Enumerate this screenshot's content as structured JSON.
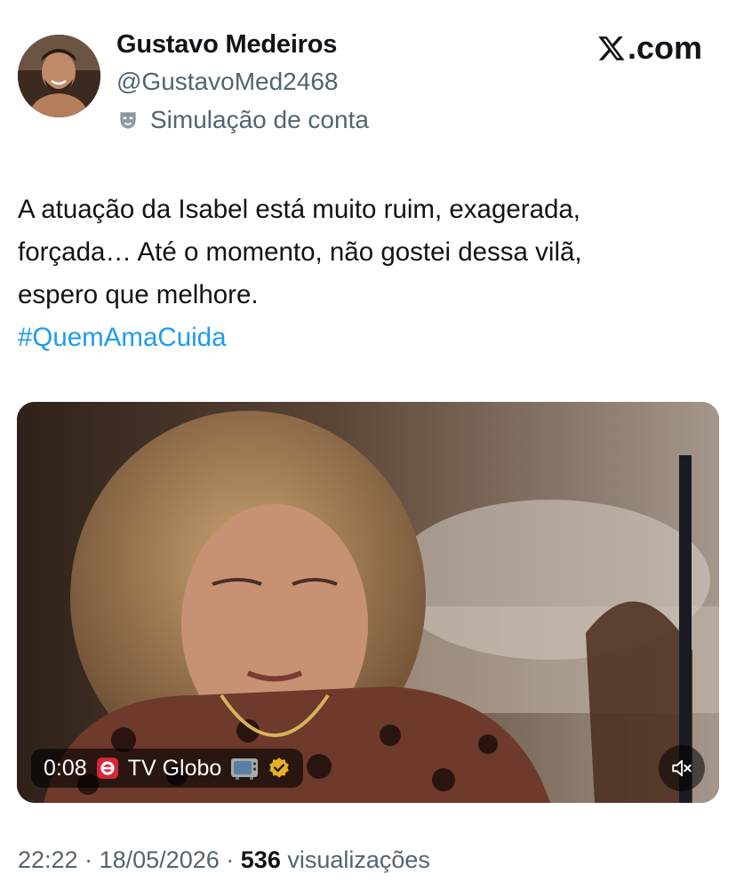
{
  "author": {
    "name": "Gustavo Medeiros",
    "handle": "@GustavoMed2468",
    "label": "Simulação de conta",
    "label_icon": "theater-mask-icon"
  },
  "brand": {
    "text": ".com",
    "icon": "x-logo-icon"
  },
  "tweet": {
    "lines": [
      "A atuação da Isabel está muito ruim, exagerada,",
      "forçada… Até o momento, não gostei dessa vilã,",
      "espero que melhore."
    ],
    "hashtag": "#QuemAmaCuida"
  },
  "video": {
    "time": "0:08",
    "channel": "TV Globo",
    "icons": [
      "globo-icon",
      "tv-icon",
      "verified-badge-icon",
      "muted-speaker-icon"
    ]
  },
  "meta": {
    "time": "22:22",
    "separator": "·",
    "date": "18/05/2026",
    "views_count": "536",
    "views_label": "visualizações"
  },
  "colors": {
    "text": "#0f1419",
    "secondary": "#536471",
    "link": "#1d9bf0"
  }
}
